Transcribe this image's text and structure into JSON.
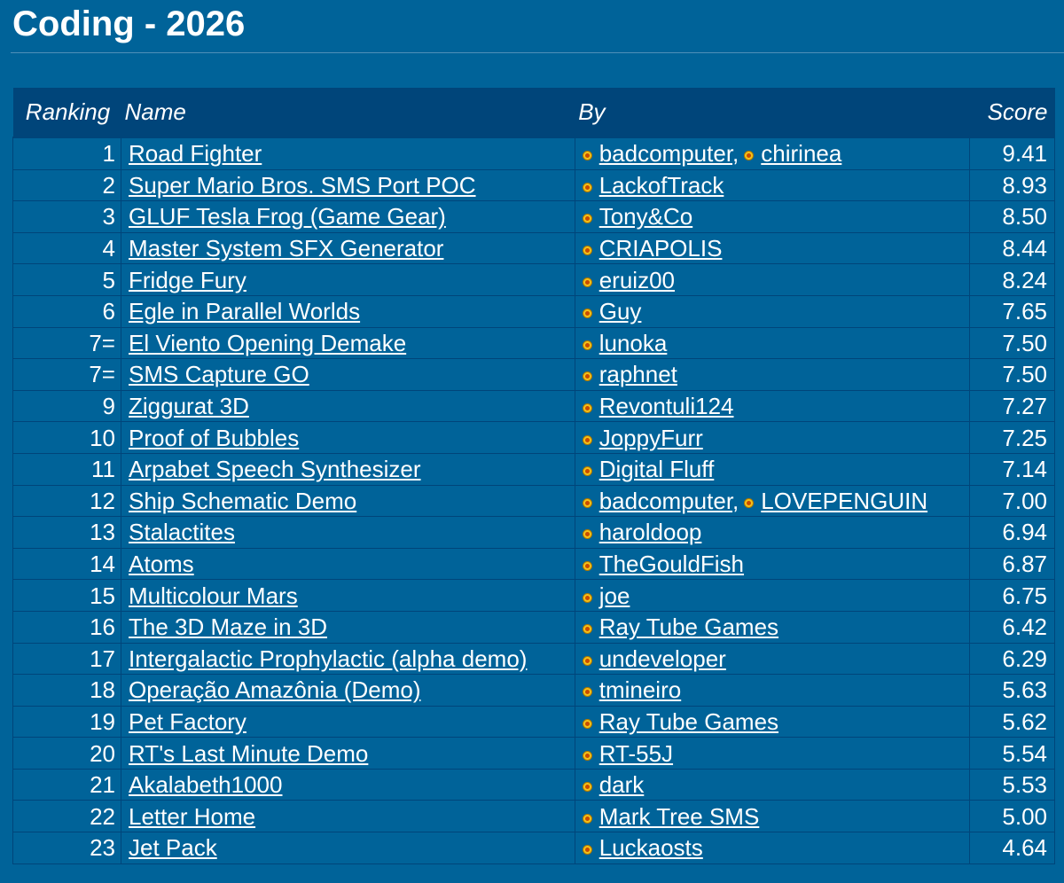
{
  "page": {
    "title": "Coding - 2026"
  },
  "table": {
    "headers": {
      "ranking": "Ranking",
      "name": "Name",
      "by": "By",
      "score": "Score"
    },
    "rows": [
      {
        "rank": "1",
        "name": "Road Fighter",
        "authors": [
          "badcomputer",
          "chirinea"
        ],
        "score": "9.41"
      },
      {
        "rank": "2",
        "name": "Super Mario Bros. SMS Port POC",
        "authors": [
          "LackofTrack"
        ],
        "score": "8.93"
      },
      {
        "rank": "3",
        "name": "GLUF Tesla Frog (Game Gear)",
        "authors": [
          "Tony&Co"
        ],
        "score": "8.50"
      },
      {
        "rank": "4",
        "name": "Master System SFX Generator",
        "authors": [
          "CRIAPOLIS"
        ],
        "score": "8.44"
      },
      {
        "rank": "5",
        "name": "Fridge Fury",
        "authors": [
          "eruiz00"
        ],
        "score": "8.24"
      },
      {
        "rank": "6",
        "name": "Egle in Parallel Worlds",
        "authors": [
          "Guy"
        ],
        "score": "7.65"
      },
      {
        "rank": "7=",
        "name": "El Viento Opening Demake",
        "authors": [
          "lunoka"
        ],
        "score": "7.50"
      },
      {
        "rank": "7=",
        "name": "SMS Capture GO",
        "authors": [
          "raphnet"
        ],
        "score": "7.50"
      },
      {
        "rank": "9",
        "name": "Ziggurat 3D",
        "authors": [
          "Revontuli124"
        ],
        "score": "7.27"
      },
      {
        "rank": "10",
        "name": "Proof of Bubbles",
        "authors": [
          "JoppyFurr"
        ],
        "score": "7.25"
      },
      {
        "rank": "11",
        "name": "Arpabet Speech Synthesizer",
        "authors": [
          "Digital Fluff"
        ],
        "score": "7.14"
      },
      {
        "rank": "12",
        "name": "Ship Schematic Demo",
        "authors": [
          "badcomputer",
          "LOVEPENGUIN"
        ],
        "score": "7.00"
      },
      {
        "rank": "13",
        "name": "Stalactites",
        "authors": [
          "haroldoop"
        ],
        "score": "6.94"
      },
      {
        "rank": "14",
        "name": "Atoms",
        "authors": [
          "TheGouldFish"
        ],
        "score": "6.87"
      },
      {
        "rank": "15",
        "name": "Multicolour Mars",
        "authors": [
          "joe"
        ],
        "score": "6.75"
      },
      {
        "rank": "16",
        "name": "The 3D Maze in 3D",
        "authors": [
          "Ray Tube Games"
        ],
        "score": "6.42"
      },
      {
        "rank": "17",
        "name": "Intergalactic Prophylactic (alpha demo)",
        "authors": [
          "undeveloper"
        ],
        "score": "6.29"
      },
      {
        "rank": "18",
        "name": "Operação Amazônia (Demo)",
        "authors": [
          "tmineiro"
        ],
        "score": "5.63"
      },
      {
        "rank": "19",
        "name": "Pet Factory",
        "authors": [
          "Ray Tube Games"
        ],
        "score": "5.62"
      },
      {
        "rank": "20",
        "name": "RT's Last Minute Demo",
        "authors": [
          "RT-55J"
        ],
        "score": "5.54"
      },
      {
        "rank": "21",
        "name": "Akalabeth1000",
        "authors": [
          "dark"
        ],
        "score": "5.53"
      },
      {
        "rank": "22",
        "name": "Letter Home",
        "authors": [
          "Mark Tree SMS"
        ],
        "score": "5.00"
      },
      {
        "rank": "23",
        "name": "Jet Pack",
        "authors": [
          "Luckaosts"
        ],
        "score": "4.64"
      }
    ]
  },
  "icons": {
    "author": "user-icon"
  },
  "colors": {
    "background": "#006399",
    "header": "#00457a",
    "text": "#ffffff",
    "user_icon": "#f3c21a"
  }
}
